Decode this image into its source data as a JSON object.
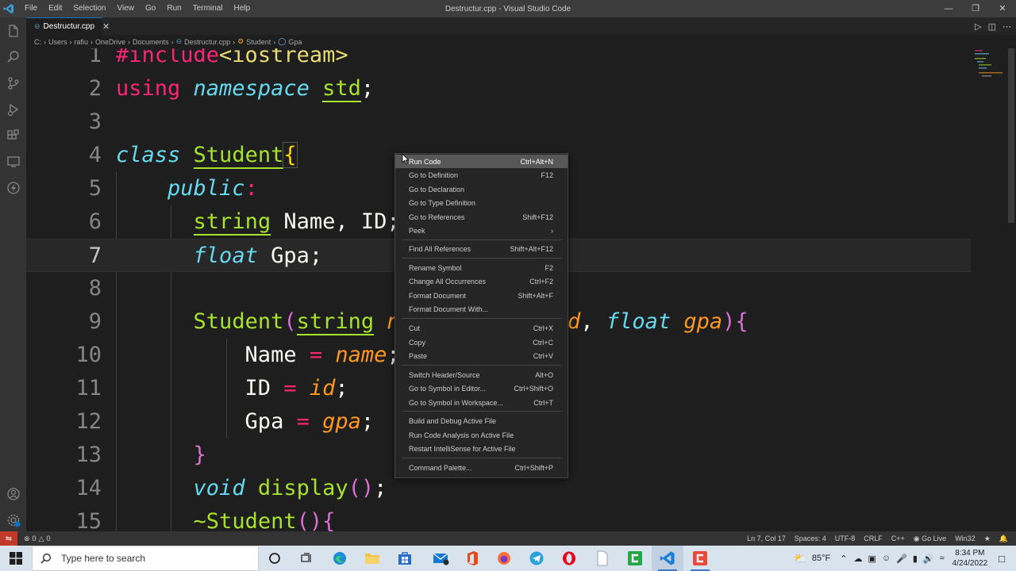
{
  "titlebar": {
    "menu": [
      "File",
      "Edit",
      "Selection",
      "View",
      "Go",
      "Run",
      "Terminal",
      "Help"
    ],
    "window_title": "Destructur.cpp - Visual Studio Code"
  },
  "tab": {
    "label": "Destructur.cpp"
  },
  "breadcrumb": [
    "C:",
    "Users",
    "rafiu",
    "OneDrive",
    "Documents",
    "Destructur.cpp",
    "Student",
    "Gpa"
  ],
  "editor": {
    "line_numbers": [
      "1",
      "2",
      "3",
      "4",
      "5",
      "6",
      "7",
      "8",
      "9",
      "10",
      "11",
      "12",
      "13",
      "14",
      "15"
    ],
    "current_line": "7"
  },
  "context_menu": {
    "items": [
      {
        "label": "Run Code",
        "key": "Ctrl+Alt+N"
      },
      {
        "label": "Go to Definition",
        "key": "F12"
      },
      {
        "label": "Go to Declaration",
        "key": ""
      },
      {
        "label": "Go to Type Definition",
        "key": ""
      },
      {
        "label": "Go to References",
        "key": "Shift+F12"
      },
      {
        "label": "Peek",
        "key": ""
      },
      {
        "label": "Find All References",
        "key": "Shift+Alt+F12"
      },
      {
        "label": "Rename Symbol",
        "key": "F2"
      },
      {
        "label": "Change All Occurrences",
        "key": "Ctrl+F2"
      },
      {
        "label": "Format Document",
        "key": "Shift+Alt+F"
      },
      {
        "label": "Format Document With...",
        "key": ""
      },
      {
        "label": "Cut",
        "key": "Ctrl+X"
      },
      {
        "label": "Copy",
        "key": "Ctrl+C"
      },
      {
        "label": "Paste",
        "key": "Ctrl+V"
      },
      {
        "label": "Switch Header/Source",
        "key": "Alt+O"
      },
      {
        "label": "Go to Symbol in Editor...",
        "key": "Ctrl+Shift+O"
      },
      {
        "label": "Go to Symbol in Workspace...",
        "key": "Ctrl+T"
      },
      {
        "label": "Build and Debug Active File",
        "key": ""
      },
      {
        "label": "Run Code Analysis on Active File",
        "key": ""
      },
      {
        "label": "Restart IntelliSense for Active File",
        "key": ""
      },
      {
        "label": "Command Palette...",
        "key": "Ctrl+Shift+P"
      }
    ]
  },
  "statusbar": {
    "errors": "0",
    "warnings": "0",
    "position": "Ln 7, Col 17",
    "spaces": "Spaces: 4",
    "encoding": "UTF-8",
    "eol": "CRLF",
    "language": "C++",
    "golive": "Go Live",
    "platform": "Win32"
  },
  "taskbar": {
    "search_placeholder": "Type here to search",
    "weather": "85°F",
    "time": "8:34 PM",
    "date": "4/24/2022"
  },
  "colors": {
    "accent_blue": "#0e70c0",
    "remote_red": "#c0392b",
    "keyword": "#f92672",
    "type": "#66d9ef",
    "class": "#a6e22e",
    "param": "#fd971f"
  }
}
